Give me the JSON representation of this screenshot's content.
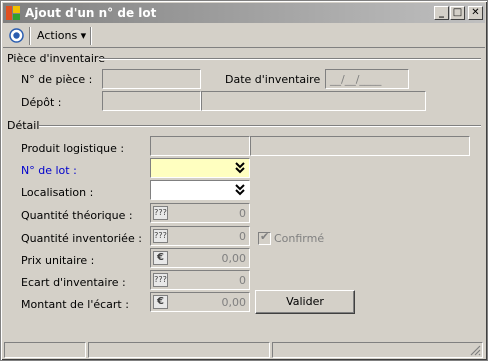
{
  "window": {
    "title": "Ajout d'un n° de lot",
    "controls": {
      "minimize": "_",
      "maximize": "□",
      "close": "✕"
    }
  },
  "toolbar": {
    "actions_label": "Actions ▾"
  },
  "section_piece": {
    "title": "Pièce d'inventaire",
    "piece_no_label": "N° de pièce :",
    "piece_no_value": "",
    "date_label": "Date d'inventaire :",
    "date_value": "__/__/____",
    "depot_label": "Dépôt :",
    "depot_code": "",
    "depot_name": ""
  },
  "section_detail": {
    "title": "Détail",
    "produit_label": "Produit logistique :",
    "produit_value": "",
    "lot_label": "N° de lot :",
    "lot_value": "",
    "localisation_label": "Localisation :",
    "localisation_value": "",
    "qte_theorique_label": "Quantité théorique :",
    "qte_theorique_value": "0",
    "qte_inventoriee_label": "Quantité inventoriée :",
    "qte_inventoriee_value": "0",
    "confirme_label": "Confirmé",
    "confirme_checked": true,
    "prix_label": "Prix unitaire :",
    "prix_value": "0,00",
    "ecart_label": "Ecart d'inventaire :",
    "ecart_value": "0",
    "montant_label": "Montant de l'écart :",
    "montant_value": "0,00",
    "quantity_icon": "???",
    "currency_icon": "€",
    "valider_label": "Valider"
  }
}
